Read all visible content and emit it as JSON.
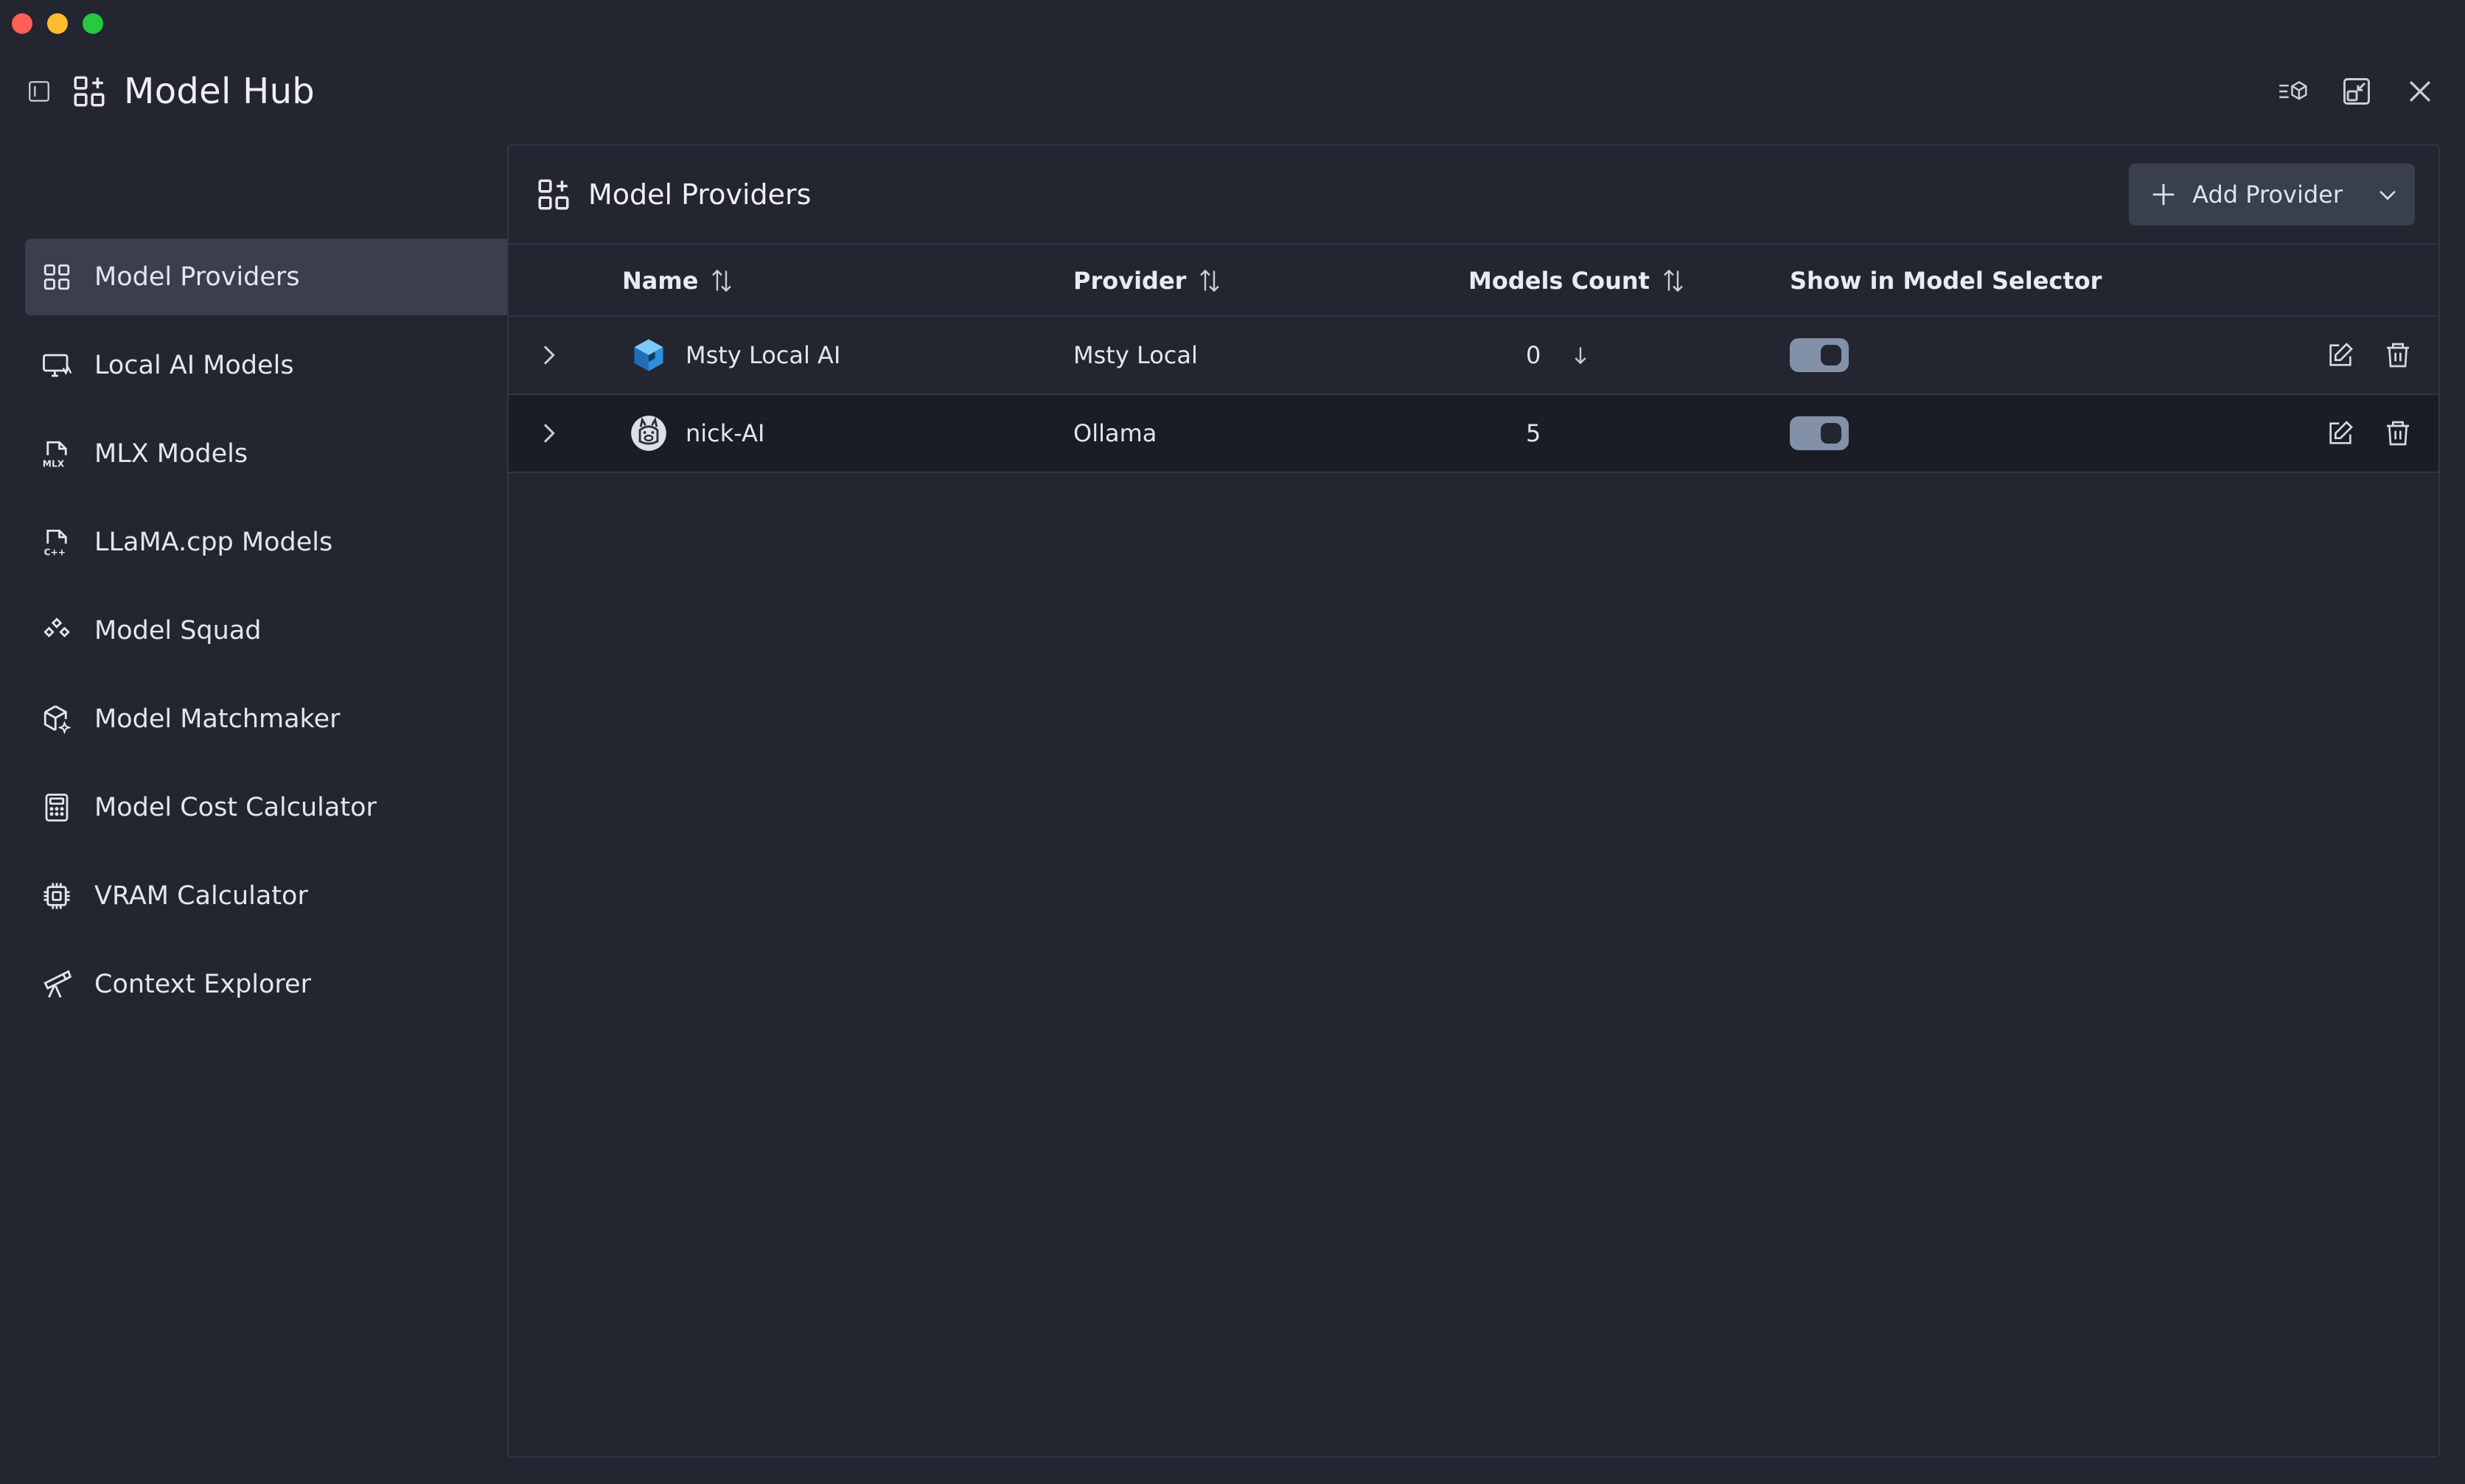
{
  "app": {
    "title": "Model Hub"
  },
  "colors": {
    "background": "#232530",
    "active_nav": "#3b3f4d",
    "toggle_on": "#8290a8",
    "alt_row": "#1b1d26",
    "border": "#323644"
  },
  "header_actions": [
    {
      "icon": "filter-models-icon"
    },
    {
      "icon": "minimize-window-icon"
    },
    {
      "icon": "close-icon"
    }
  ],
  "sidebar": {
    "items": [
      {
        "label": "Model Providers",
        "icon": "grid-plus-icon",
        "active": true
      },
      {
        "label": "Local AI Models",
        "icon": "monitor-ai-icon",
        "active": false
      },
      {
        "label": "MLX Models",
        "icon": "mlx-file-icon",
        "active": false
      },
      {
        "label": "LLaMA.cpp Models",
        "icon": "cpp-file-icon",
        "active": false
      },
      {
        "label": "Model Squad",
        "icon": "squad-icon",
        "active": false
      },
      {
        "label": "Model Matchmaker",
        "icon": "cube-sparkle-icon",
        "active": false
      },
      {
        "label": "Model Cost Calculator",
        "icon": "calculator-icon",
        "active": false
      },
      {
        "label": "VRAM Calculator",
        "icon": "chip-icon",
        "active": false
      },
      {
        "label": "Context Explorer",
        "icon": "telescope-icon",
        "active": false
      }
    ]
  },
  "panel": {
    "title": "Model Providers",
    "add_button": "Add Provider"
  },
  "table": {
    "columns": [
      "Name",
      "Provider",
      "Models Count",
      "Show in Model Selector"
    ],
    "rows": [
      {
        "name": "Msty Local AI",
        "provider": "Msty Local",
        "count": "0",
        "show": true,
        "icon": "msty-cube-icon"
      },
      {
        "name": "nick-AI",
        "provider": "Ollama",
        "count": "5",
        "show": true,
        "icon": "ollama-llama-icon"
      }
    ]
  }
}
